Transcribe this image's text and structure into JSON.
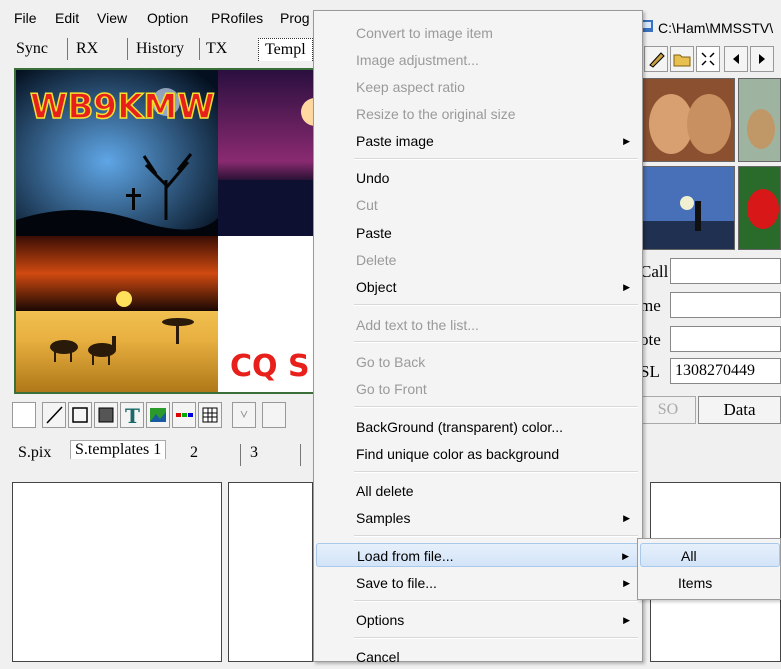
{
  "menubar": [
    "File",
    "Edit",
    "View",
    "Option",
    "PRofiles",
    "Prog"
  ],
  "tabs": [
    "Sync",
    "RX",
    "History",
    "TX",
    "Templ"
  ],
  "canvas": {
    "callsign": "WB9KMW",
    "cq_text": "CQ S"
  },
  "bottom_tabs": [
    "S.pix",
    "S.templates 1",
    "2",
    "3"
  ],
  "right_window": {
    "title": "C:\\Ham\\MMSSTV\\",
    "labels": [
      "Call",
      "me",
      "ote",
      "SL"
    ],
    "sl_value": "1308270449",
    "buttons": [
      "SO",
      "Data"
    ]
  },
  "context_menu": [
    {
      "label": "Convert to image item",
      "disabled": true
    },
    {
      "label": "Image adjustment...",
      "disabled": true
    },
    {
      "label": "Keep aspect ratio",
      "disabled": true
    },
    {
      "label": "Resize to the original size",
      "disabled": true
    },
    {
      "label": "Paste image",
      "submenu": true
    },
    {
      "label": "Undo"
    },
    {
      "label": "Cut",
      "disabled": true
    },
    {
      "label": "Paste"
    },
    {
      "label": "Delete",
      "disabled": true
    },
    {
      "label": "Object",
      "submenu": true
    },
    {
      "label": "Add text to the list...",
      "disabled": true
    },
    {
      "label": "Go to Back",
      "disabled": true
    },
    {
      "label": "Go to Front",
      "disabled": true
    },
    {
      "label": "BackGround (transparent) color..."
    },
    {
      "label": "Find unique color as background"
    },
    {
      "label": "All delete"
    },
    {
      "label": "Samples",
      "submenu": true
    },
    {
      "label": "Load from file...",
      "submenu": true,
      "highlighted": true
    },
    {
      "label": "Save to file...",
      "submenu": true
    },
    {
      "label": "Options",
      "submenu": true
    },
    {
      "label": "Cancel"
    }
  ],
  "submenu": [
    {
      "label": "All",
      "highlighted": true
    },
    {
      "label": "Items"
    }
  ]
}
